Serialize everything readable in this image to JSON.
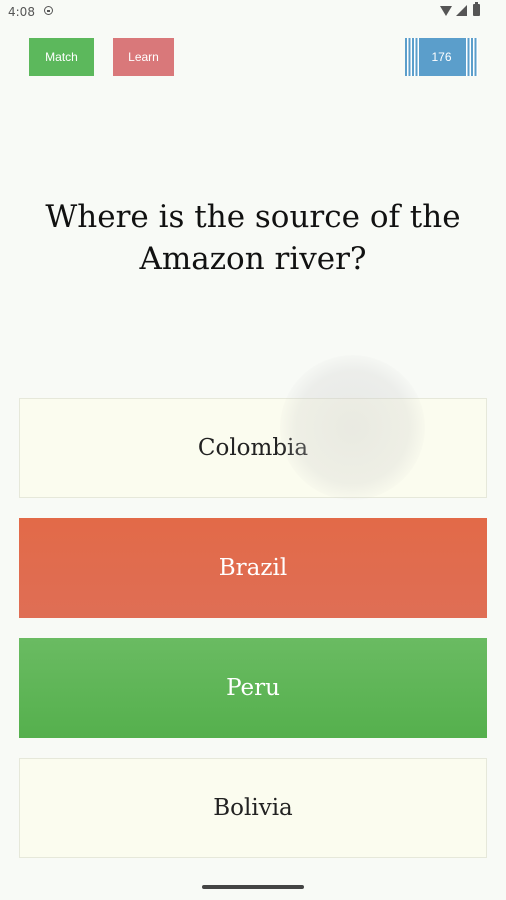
{
  "status_bar": {
    "time": "4:08",
    "icons": [
      "clock-icon",
      "wifi-icon",
      "signal-icon",
      "battery-icon"
    ]
  },
  "toolbar": {
    "match_label": "Match",
    "learn_label": "Learn",
    "score": "176"
  },
  "question": {
    "text": "Where is the source of the Amazon river?"
  },
  "answers": [
    {
      "label": "Colombia",
      "state": "neutral"
    },
    {
      "label": "Brazil",
      "state": "wrong"
    },
    {
      "label": "Peru",
      "state": "correct"
    },
    {
      "label": "Bolivia",
      "state": "neutral"
    }
  ],
  "colors": {
    "match_button": "#5cb85c",
    "learn_button": "#d9787a",
    "score_badge": "#5b9ecb",
    "wrong_answer": "#e06b4f",
    "correct_answer": "#5fb657",
    "neutral_answer": "#fbfcef",
    "background": "#f8faf6"
  }
}
